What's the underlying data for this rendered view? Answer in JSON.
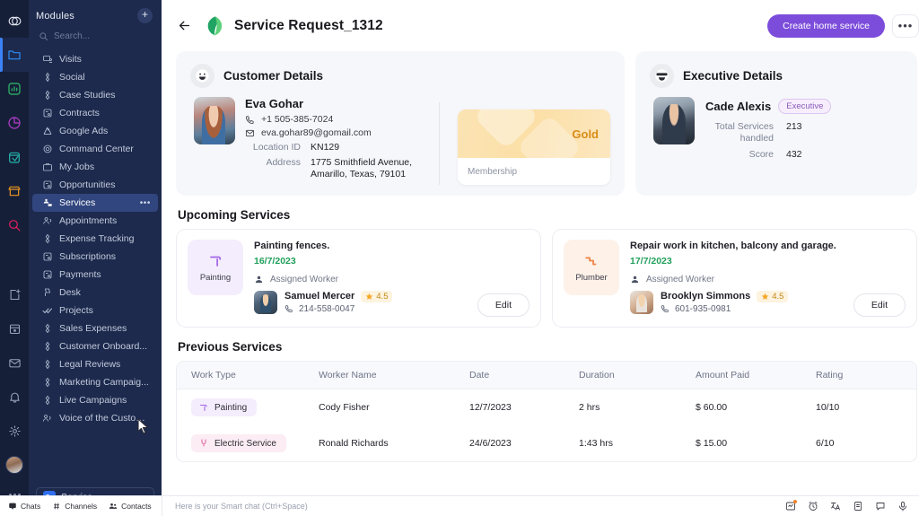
{
  "sidebar": {
    "title": "Modules",
    "add_label": "+",
    "search_placeholder": "Search...",
    "items": [
      {
        "label": "Visits",
        "icon": "monitor-user-icon",
        "active": false
      },
      {
        "label": "Social",
        "icon": "diamond-icon",
        "active": false
      },
      {
        "label": "Case Studies",
        "icon": "diamond-icon",
        "active": false
      },
      {
        "label": "Contracts",
        "icon": "document-icon",
        "active": false
      },
      {
        "label": "Google Ads",
        "icon": "google-ads-icon",
        "active": false
      },
      {
        "label": "Command Center",
        "icon": "target-icon",
        "active": false
      },
      {
        "label": "My Jobs",
        "icon": "briefcase-icon",
        "active": false
      },
      {
        "label": "Opportunities",
        "icon": "document-icon",
        "active": false
      },
      {
        "label": "Services",
        "icon": "services-icon",
        "active": true,
        "more": "•••"
      },
      {
        "label": "Appointments",
        "icon": "people-icon",
        "active": false
      },
      {
        "label": "Expense Tracking",
        "icon": "diamond-icon",
        "active": false
      },
      {
        "label": "Subscriptions",
        "icon": "document-icon",
        "active": false
      },
      {
        "label": "Payments",
        "icon": "document-icon",
        "active": false
      },
      {
        "label": "Desk",
        "icon": "desk-icon",
        "active": false
      },
      {
        "label": "Projects",
        "icon": "double-check-icon",
        "active": false
      },
      {
        "label": "Sales Expenses",
        "icon": "diamond-icon",
        "active": false
      },
      {
        "label": "Customer Onboard...",
        "icon": "diamond-icon",
        "active": false
      },
      {
        "label": "Legal Reviews",
        "icon": "diamond-icon",
        "active": false
      },
      {
        "label": "Marketing Campaig...",
        "icon": "diamond-icon",
        "active": false
      },
      {
        "label": "Live Campaigns",
        "icon": "diamond-icon",
        "active": false
      },
      {
        "label": "Voice of the Customer",
        "icon": "voice-user-icon",
        "active": false
      }
    ],
    "footer_select": {
      "badge": "Se",
      "label": "Service"
    }
  },
  "header": {
    "back_icon": "back-arrow-icon",
    "logo_icon": "leaf-logo-icon",
    "title": "Service Request_1312",
    "primary_button": "Create home service",
    "overflow_button": "•••",
    "accent_color": "#7c4ddb"
  },
  "customer": {
    "section_title": "Customer Details",
    "header_icon": "smiley-face-icon",
    "name": "Eva Gohar",
    "phone": "+1 505-385-7024",
    "email": "eva.gohar89@gomail.com",
    "location_id_label": "Location ID",
    "location_id": "KN129",
    "address_label": "Address",
    "address": "1775 Smithfield Avenue, Amarillo, Texas, 79101",
    "membership": {
      "tier": "Gold",
      "label": "Membership",
      "tier_color": "#d98c18"
    }
  },
  "executive": {
    "section_title": "Executive Details",
    "header_icon": "sunglasses-face-icon",
    "name": "Cade Alexis",
    "role_badge": "Executive",
    "stats": [
      {
        "label": "Total Services handled",
        "value": "213"
      },
      {
        "label": "Score",
        "value": "432"
      }
    ]
  },
  "upcoming": {
    "section_title": "Upcoming Services",
    "assigned_worker_label": "Assigned Worker",
    "edit_label": "Edit",
    "cards": [
      {
        "badge_label": "Painting",
        "badge_icon": "paint-roller-icon",
        "title": "Painting fences.",
        "date": "16/7/2023",
        "worker_name": "Samuel Mercer",
        "rating": "4.5",
        "phone": "214-558-0047"
      },
      {
        "badge_label": "Plumber",
        "badge_icon": "pipe-wrench-icon",
        "title": "Repair work in kitchen, balcony and garage.",
        "date": "17/7/2023",
        "worker_name": "Brooklyn Simmons",
        "rating": "4.5",
        "phone": "601-935-0981"
      }
    ]
  },
  "previous": {
    "section_title": "Previous Services",
    "columns": [
      "Work Type",
      "Worker Name",
      "Date",
      "Duration",
      "Amount Paid",
      "Rating"
    ],
    "rows": [
      {
        "work_type": "Painting",
        "work_type_icon": "paint-roller-icon",
        "worker_name": "Cody Fisher",
        "date": "12/7/2023",
        "duration": "2 hrs",
        "amount": "$ 60.00",
        "rating": "10/10"
      },
      {
        "work_type": "Electric Service",
        "work_type_icon": "plug-icon",
        "worker_name": "Ronald Richards",
        "date": "24/6/2023",
        "duration": "1:43 hrs",
        "amount": "$ 15.00",
        "rating": "6/10"
      }
    ]
  },
  "bottombar": {
    "tabs": [
      {
        "label": "Chats",
        "icon": "chat-bubble-icon"
      },
      {
        "label": "Channels",
        "icon": "hash-icon"
      },
      {
        "label": "Contacts",
        "icon": "contacts-icon"
      }
    ],
    "input_placeholder": "Here is your Smart chat (Ctrl+Space)",
    "right_icons": [
      "note-icon",
      "alarm-icon",
      "translate-icon",
      "document-icon",
      "comment-icon",
      "microphone-icon"
    ]
  }
}
